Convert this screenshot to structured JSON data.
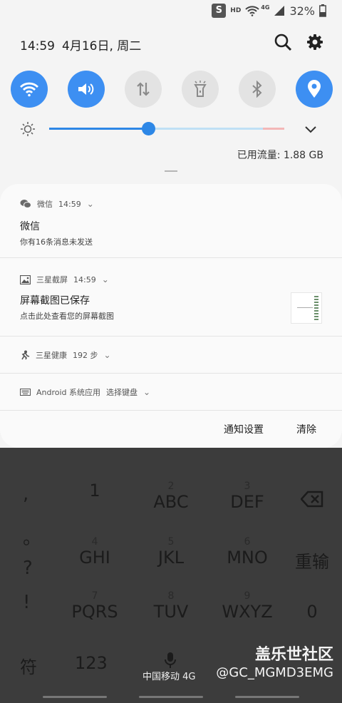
{
  "status_bar": {
    "hd": "HD",
    "network": "4G",
    "battery": "32%"
  },
  "header": {
    "time": "14:59",
    "date": "4月16日, 周二"
  },
  "quick_settings": {
    "wifi": "on",
    "sound": "on",
    "mobile_data": "off",
    "flashlight": "off",
    "bluetooth": "off",
    "location": "on"
  },
  "brightness": {
    "level": 0.42
  },
  "data_usage": "已用流量: 1.88 GB",
  "notifications": [
    {
      "app": "微信",
      "time": "14:59",
      "title": "微信",
      "text": "你有16条消息未发送"
    },
    {
      "app": "三星截屏",
      "time": "14:59",
      "title": "屏幕截图已保存",
      "text": "点击此处查看您的屏幕截图"
    },
    {
      "app": "三星健康",
      "info": "192 步"
    },
    {
      "app": "Android 系统应用",
      "info": "选择键盘"
    }
  ],
  "footer": {
    "settings": "通知设置",
    "clear": "清除"
  },
  "keyboard": {
    "symbols": [
      ",",
      "。",
      "?",
      "!"
    ],
    "keys": [
      {
        "num": "",
        "label": "1"
      },
      {
        "num": "2",
        "label": "ABC"
      },
      {
        "num": "3",
        "label": "DEF"
      },
      {
        "num": "4",
        "label": "GHI"
      },
      {
        "num": "5",
        "label": "JKL"
      },
      {
        "num": "6",
        "label": "MNO"
      },
      {
        "num": "7",
        "label": "PQRS"
      },
      {
        "num": "8",
        "label": "TUV"
      },
      {
        "num": "9",
        "label": "WXYZ"
      }
    ],
    "reenter": "重输",
    "zero": "0",
    "symbol_key": "符",
    "num_key": "123",
    "carrier": "中国移动 4G"
  },
  "watermark": {
    "line1": "盖乐世社区",
    "line2": "@GC_MGMD3EMG"
  },
  "colors": {
    "accent": "#3d8ff2",
    "panel_bg": "#f4f4f4",
    "card_bg": "#fafafa"
  }
}
